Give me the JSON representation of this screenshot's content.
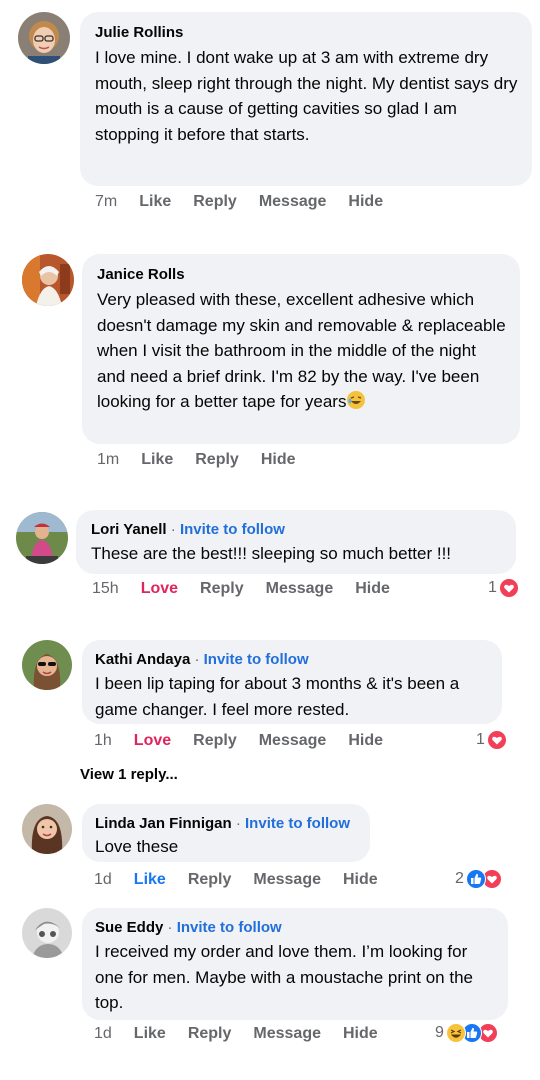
{
  "comments": [
    {
      "author": "Julie Rollins",
      "invite": "",
      "text": "I love mine. I dont wake up at 3 am with extreme dry mouth, sleep right through the night. My dentist says dry mouth is a cause of getting cavities so glad I am stopping it before that starts.",
      "time": "7m",
      "actions": [
        "Like",
        "Reply",
        "Message",
        "Hide"
      ],
      "reactions": ""
    },
    {
      "author": "Janice Rolls",
      "invite": "",
      "text": "Very pleased with these, excellent adhesive which doesn't damage my skin and removable & replaceable when I visit the bathroom in the middle of the night and need a brief drink. I'm 82 by the way. I've been looking for a better tape for years",
      "time": "1m",
      "actions": [
        "Like",
        "Reply",
        "Hide"
      ],
      "reactions": ""
    },
    {
      "author": "Lori Yanell",
      "invite": "Invite to follow",
      "text": "These are the best!!!  sleeping so much better !!!",
      "time": "15h",
      "actions": [
        "Love",
        "Reply",
        "Message",
        "Hide"
      ],
      "reactions": "1"
    },
    {
      "author": "Kathi Andaya",
      "invite": "Invite to follow",
      "text": "I been lip taping for about 3 months & it's been a game changer.  I feel more rested.",
      "time": "1h",
      "actions": [
        "Love",
        "Reply",
        "Message",
        "Hide"
      ],
      "reactions": "1",
      "view_replies": "View 1 reply..."
    },
    {
      "author": "Linda Jan Finnigan",
      "invite": "Invite to follow",
      "text": "Love these",
      "time": "1d",
      "actions": [
        "Like",
        "Reply",
        "Message",
        "Hide"
      ],
      "reactions": "2"
    },
    {
      "author": "Sue Eddy",
      "invite": "Invite to follow",
      "text": "I received my order and love them. I’m looking for one for men. Maybe with a moustache print on the top.",
      "time": "1d",
      "actions": [
        "Like",
        "Reply",
        "Message",
        "Hide"
      ],
      "reactions": "9"
    }
  ],
  "separator": "·",
  "colors": {
    "bubble": "#f0f2f5",
    "love": "#e0245e",
    "like": "#1877f2",
    "invite": "#216fdb",
    "muted": "#65676b"
  },
  "icons": [
    "laughing-emoji-icon",
    "heart-reaction-icon",
    "like-reaction-icon",
    "haha-reaction-icon"
  ]
}
